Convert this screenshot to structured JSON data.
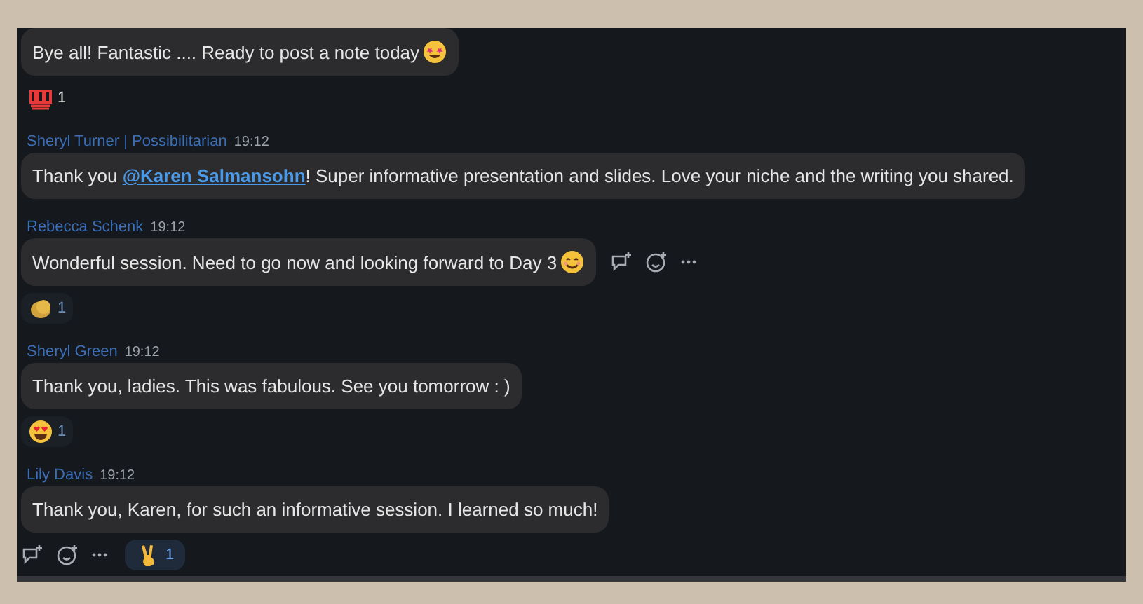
{
  "messages": [
    {
      "text": "Bye all! Fantastic .... Ready to post a note today",
      "emoji": {
        "kind": "starstruck"
      },
      "actions": false,
      "reactions": [
        {
          "kind": "hundred",
          "count": "1",
          "selected": false
        }
      ]
    },
    {
      "author": "Sheryl Turner | Possibilitarian",
      "time": "19:12",
      "text": "Thank you **@Karen Salmansohn**! Super informative presentation and slides. Love your niche and the writing you shared.",
      "actions": false
    },
    {
      "author": "Rebecca Schenk",
      "time": "19:12",
      "text": "Wonderful session. Need to go now and looking forward to Day 3",
      "emoji": {
        "kind": "smile"
      },
      "actions": true,
      "reactions": [
        {
          "kind": "clap",
          "count": "1",
          "selected": false
        }
      ]
    },
    {
      "author": "Sheryl Green",
      "time": "19:12",
      "text": "Thank you, ladies. This was fabulous. See you tomorrow : )",
      "actions": false,
      "reactions": [
        {
          "kind": "heart-eyes",
          "count": "1",
          "selected": false
        }
      ]
    },
    {
      "author": "Lily Davis",
      "time": "19:12",
      "text": "Thank you, Karen, for such an informative session. I learned so much!",
      "actions": true,
      "reactions": [
        {
          "kind": "victory",
          "count": "1",
          "selected": true
        }
      ]
    }
  ]
}
